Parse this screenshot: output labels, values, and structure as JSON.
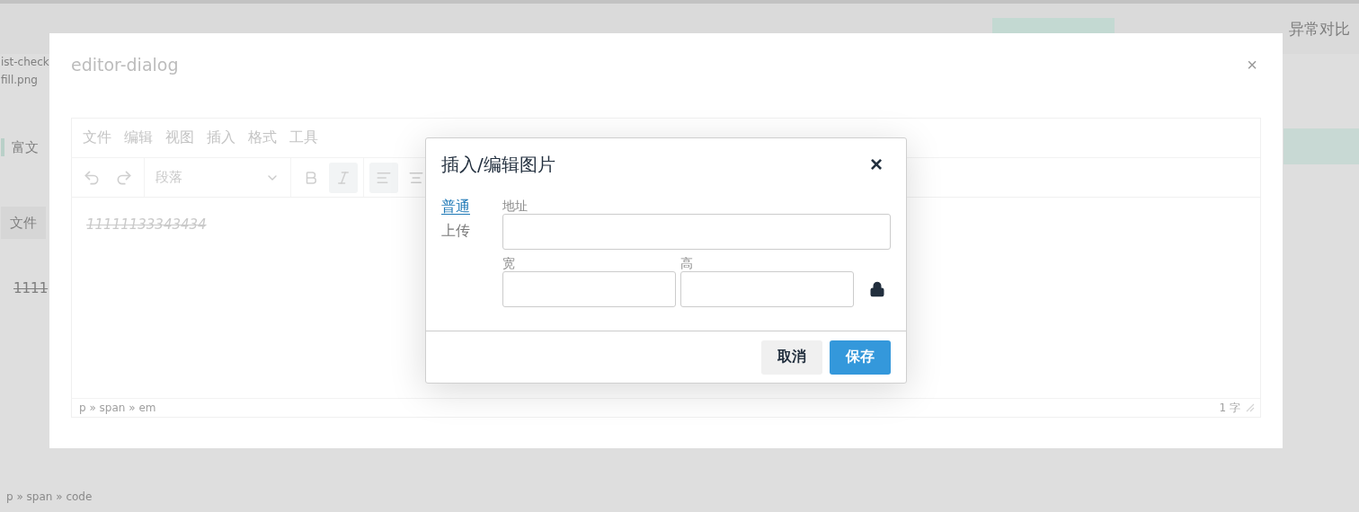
{
  "background": {
    "tab_suffix": "异常对比",
    "file_lines": [
      "ist-check",
      "fill.png"
    ],
    "section_title": "富文",
    "menu_item": "文件",
    "content": "1111",
    "path": "p » span » code"
  },
  "editor_dialog": {
    "title": "editor-dialog",
    "close": "×",
    "menu": [
      "文件",
      "编辑",
      "视图",
      "插入",
      "格式",
      "工具"
    ],
    "toolbar": [
      {
        "kind": "undo",
        "active": false
      },
      {
        "kind": "redo",
        "active": false
      },
      {
        "kind": "select",
        "label": "段落"
      },
      {
        "kind": "bold",
        "active": false
      },
      {
        "kind": "italic",
        "active": true
      },
      {
        "kind": "align-left",
        "active": true
      },
      {
        "kind": "align-center",
        "active": false
      }
    ],
    "content": "11111133343434",
    "path": "p » span » em",
    "word_count": "1 字"
  },
  "image_dialog": {
    "title": "插入/编辑图片",
    "close": "×",
    "tabs": [
      {
        "label": "普通",
        "selected": true
      },
      {
        "label": "上传",
        "selected": false
      }
    ],
    "fields": {
      "url_label": "地址",
      "width_label": "宽",
      "height_label": "高",
      "locked": true
    },
    "buttons": [
      {
        "label": "取消",
        "kind": "secondary"
      },
      {
        "label": "保存",
        "kind": "primary"
      }
    ]
  }
}
